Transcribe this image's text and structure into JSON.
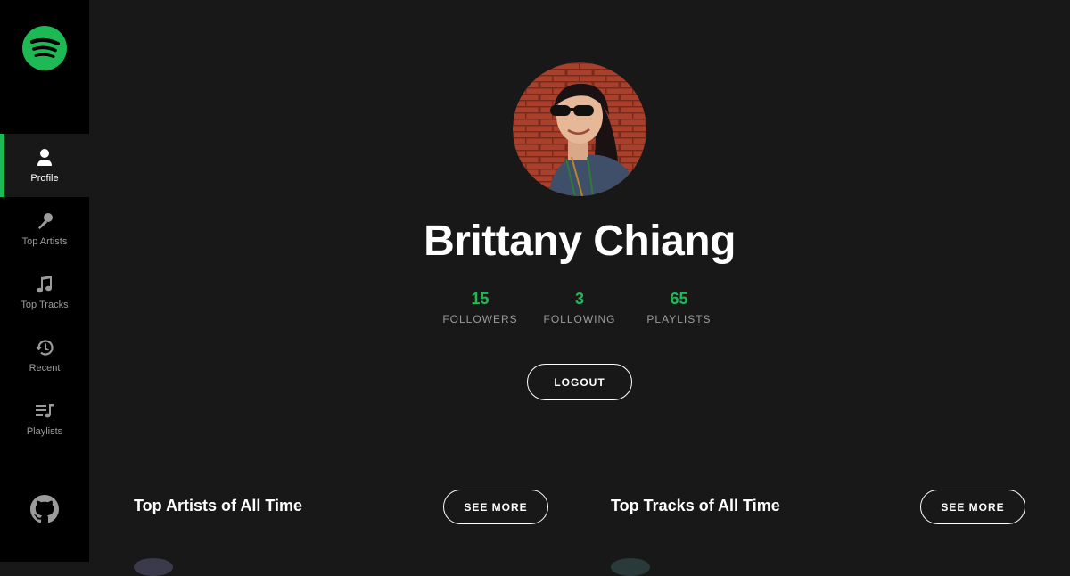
{
  "colors": {
    "accent": "#1db954",
    "sidebar_bg": "#000000",
    "page_bg": "#181818",
    "muted_text": "#9b9b9b"
  },
  "sidebar": {
    "logo_icon": "spotify-logo-icon",
    "items": [
      {
        "label": "Profile",
        "icon": "user-icon",
        "active": true
      },
      {
        "label": "Top Artists",
        "icon": "microphone-icon",
        "active": false
      },
      {
        "label": "Top Tracks",
        "icon": "music-note-icon",
        "active": false
      },
      {
        "label": "Recent",
        "icon": "history-icon",
        "active": false
      },
      {
        "label": "Playlists",
        "icon": "playlist-icon",
        "active": false
      }
    ],
    "footer_icon": "github-icon"
  },
  "profile": {
    "name": "Brittany Chiang",
    "stats": [
      {
        "value": "15",
        "label": "FOLLOWERS"
      },
      {
        "value": "3",
        "label": "FOLLOWING"
      },
      {
        "value": "65",
        "label": "PLAYLISTS"
      }
    ],
    "logout_label": "LOGOUT"
  },
  "sections": {
    "top_artists": {
      "title": "Top Artists of All Time",
      "button": "SEE MORE"
    },
    "top_tracks": {
      "title": "Top Tracks of All Time",
      "button": "SEE MORE"
    }
  }
}
